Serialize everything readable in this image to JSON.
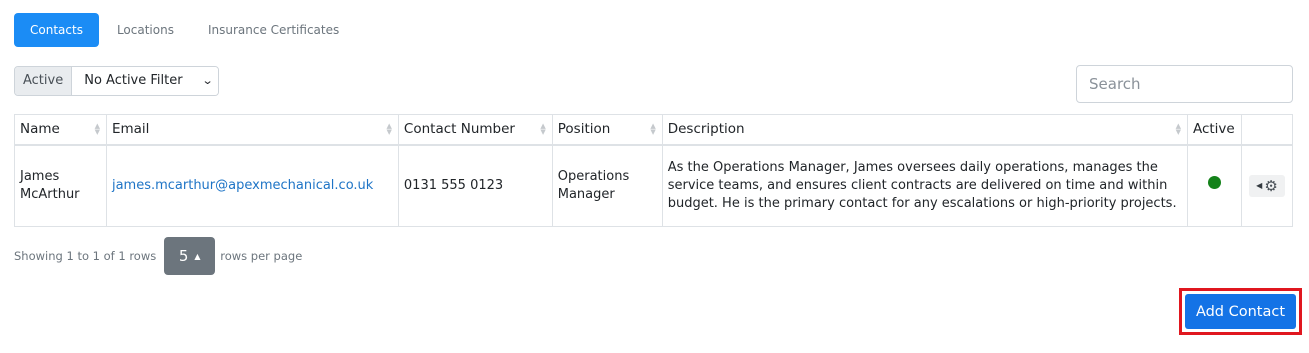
{
  "tabs": [
    {
      "label": "Contacts",
      "active": true
    },
    {
      "label": "Locations",
      "active": false
    },
    {
      "label": "Insurance Certificates",
      "active": false
    }
  ],
  "filter": {
    "label": "Active",
    "selected": "No Active Filter"
  },
  "search": {
    "placeholder": "Search"
  },
  "table": {
    "columns": [
      "Name",
      "Email",
      "Contact Number",
      "Position",
      "Description",
      "Active"
    ],
    "rows": [
      {
        "name": "James McArthur",
        "email": "james.mcarthur@apexmechanical.co.uk",
        "contact_number": "0131 555 0123",
        "position": "Operations Manager",
        "description": "As the Operations Manager, James oversees daily operations, manages the service teams, and ensures client contracts are delivered on time and within budget. He is the primary contact for any escalations or high-priority projects.",
        "active": true
      }
    ]
  },
  "pagination": {
    "showing": "Showing 1 to 1 of 1 rows",
    "page_size": "5",
    "rows_per_page": "rows per page"
  },
  "add_contact_label": "Add Contact",
  "colors": {
    "primary": "#1b8cf5",
    "button": "#1473e6",
    "active_dot": "#14821a",
    "highlight": "#e0171f"
  }
}
